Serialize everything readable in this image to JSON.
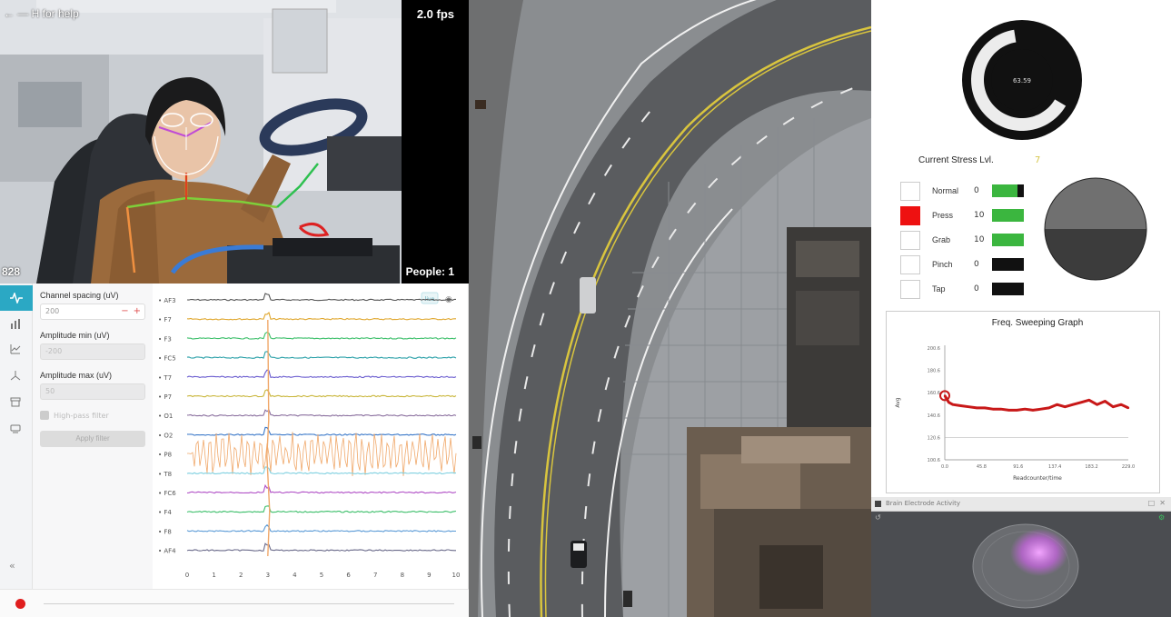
{
  "camera": {
    "help_hint": "← — H for help",
    "fps": "2.0 fps",
    "frame_count": "828",
    "people": "People:  1"
  },
  "eeg": {
    "settings": {
      "channel_spacing_label": "Channel spacing (uV)",
      "channel_spacing_value": "200",
      "stepper_minus": "−",
      "stepper_plus": "+",
      "amp_min_label": "Amplitude min (uV)",
      "amp_min_value": "-200",
      "amp_max_label": "Amplitude max (uV)",
      "amp_max_value": "50",
      "highpass_label": "High-pass filter",
      "apply_label": "Apply filter"
    },
    "collapse_icon": "«",
    "channels": [
      {
        "name": "AF3",
        "color": "#555555"
      },
      {
        "name": "F7",
        "color": "#e0a72e"
      },
      {
        "name": "F3",
        "color": "#3cbf6a"
      },
      {
        "name": "FC5",
        "color": "#2aa0a8"
      },
      {
        "name": "T7",
        "color": "#6a5ccf"
      },
      {
        "name": "P7",
        "color": "#c9b63a"
      },
      {
        "name": "O1",
        "color": "#8a6f9e"
      },
      {
        "name": "O2",
        "color": "#3a78c9"
      },
      {
        "name": "P8",
        "color": "#f0a86a"
      },
      {
        "name": "T8",
        "color": "#7fd0e0"
      },
      {
        "name": "FC6",
        "color": "#b04fc6"
      },
      {
        "name": "F4",
        "color": "#3cbf6a"
      },
      {
        "name": "F8",
        "color": "#5a9ad6"
      },
      {
        "name": "AF4",
        "color": "#6a6a8a"
      }
    ],
    "x_ticks": [
      "0",
      "1",
      "2",
      "3",
      "4",
      "5",
      "6",
      "7",
      "8",
      "9",
      "10"
    ],
    "badge": "live"
  },
  "stress": {
    "label": "Current Stress Lvl.",
    "value": "7",
    "gauge_text": "63.59",
    "gauge_fraction": 0.64
  },
  "gestures": [
    {
      "name": "Normal",
      "value": "0",
      "swatch": "#ffffff",
      "fill": 0.8
    },
    {
      "name": "Press",
      "value": "10",
      "swatch": "#ee1111",
      "fill": 1.0
    },
    {
      "name": "Grab",
      "value": "10",
      "swatch": "#ffffff",
      "fill": 1.0
    },
    {
      "name": "Pinch",
      "value": "0",
      "swatch": "#ffffff",
      "fill": 0
    },
    {
      "name": "Tap",
      "value": "0",
      "swatch": "#ffffff",
      "fill": 0
    }
  ],
  "pie": {
    "top_color": "#707070",
    "bottom_color": "#3c3c3c"
  },
  "chart_data": {
    "type": "line",
    "title": "Freq. Sweeping Graph",
    "xlabel": "Readcounter/time",
    "ylabel": "Avg",
    "x_ticks": [
      "0.0",
      "45.8",
      "91.6",
      "137.4",
      "183.2",
      "229.0"
    ],
    "y_ticks": [
      "200.6",
      "180.6",
      "160.6",
      "140.6",
      "120.6",
      "100.6"
    ],
    "xlim": [
      0,
      229
    ],
    "ylim": [
      100.6,
      200.6
    ],
    "series": [
      {
        "color": "#c81818",
        "x": [
          0,
          5,
          10,
          20,
          30,
          40,
          50,
          60,
          70,
          80,
          90,
          100,
          110,
          120,
          130,
          140,
          150,
          160,
          170,
          180,
          190,
          200,
          210,
          220,
          229
        ],
        "y": [
          158,
          152,
          150,
          149,
          148,
          147,
          147,
          146,
          146,
          145,
          145,
          146,
          145,
          146,
          147,
          150,
          148,
          150,
          152,
          154,
          150,
          153,
          148,
          150,
          147
        ]
      }
    ]
  },
  "brain": {
    "title": "Brain Electrode Activity"
  }
}
